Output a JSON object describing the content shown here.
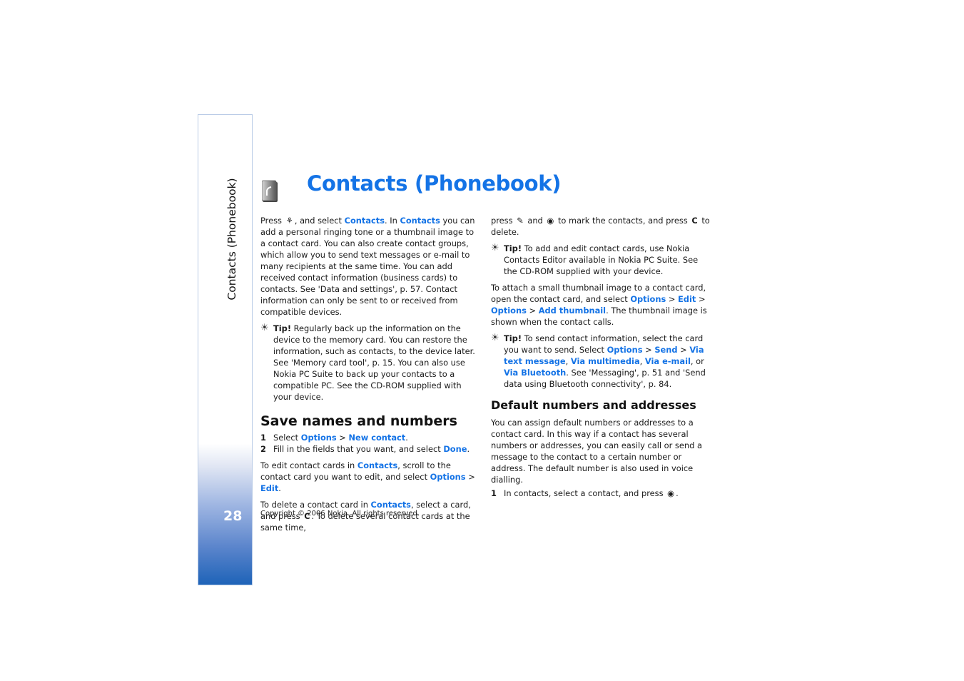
{
  "sidebar": {
    "section_title": "Contacts (Phonebook)",
    "page_number": "28",
    "gradient_colors": [
      "#ffffff",
      "#9fb6e2",
      "#1e63b8"
    ]
  },
  "header": {
    "title": "Contacts (Phonebook)",
    "icon": "contacts-book-icon",
    "accent_color": "#1473e6"
  },
  "col1": {
    "intro": {
      "t1": "Press ",
      "t2": ", and select ",
      "k1": "Contacts",
      "t3": ". In ",
      "k2": "Contacts",
      "t4": " you can add a personal ringing tone or a thumbnail image to a contact card. You can also create contact groups, which allow you to send text messages or e-mail to many recipients at the same time. You can add received contact information (business cards) to contacts. See 'Data and settings', p. 57. Contact information can only be sent to or received from compatible devices."
    },
    "tip": {
      "label": "Tip!",
      "text": " Regularly back up the information on the device to the memory card. You can restore the information, such as contacts, to the device later. See 'Memory card tool', p. 15. You can also use Nokia PC Suite to back up your contacts to a compatible PC. See the CD-ROM supplied with your device."
    },
    "heading": "Save names and numbers",
    "steps": [
      {
        "num": "1",
        "t1": "Select ",
        "k1": "Options",
        "t2": " > ",
        "k2": "New contact",
        "t3": "."
      },
      {
        "num": "2",
        "t1": "Fill in the fields that you want, and select ",
        "k1": "Done",
        "t2": "."
      }
    ],
    "edit": {
      "t1": "To edit contact cards in ",
      "k1": "Contacts",
      "t2": ", scroll to the contact card you want to edit, and select ",
      "k2": "Options",
      "t3": " > ",
      "k3": "Edit",
      "t4": "."
    },
    "delete": {
      "t1": "To delete a contact card in ",
      "k1": "Contacts",
      "t2": ", select a card, and press ",
      "t3": ". To delete several contact cards at the same time,"
    }
  },
  "col2": {
    "cont": {
      "t1": "press ",
      "t2": " and ",
      "t3": " to mark the contacts, and press ",
      "t4": " to delete."
    },
    "tip1": {
      "label": "Tip!",
      "text": " To add and edit contact cards, use Nokia Contacts Editor available in Nokia PC Suite. See the CD-ROM supplied with your device."
    },
    "thumb": {
      "t1": "To attach a small thumbnail image to a contact card, open the contact card, and select ",
      "k1": "Options",
      "t2": " > ",
      "k2": "Edit",
      "t3": " > ",
      "k3": "Options",
      "t4": " > ",
      "k4": "Add thumbnail",
      "t5": ". The thumbnail image is shown when the contact calls."
    },
    "tip2": {
      "label": "Tip!",
      "t1": " To send contact information, select the card you want to send. Select ",
      "k1": "Options",
      "t2": " > ",
      "k2": "Send",
      "t3": " > ",
      "k3": "Via text message",
      "t4": ", ",
      "k4": "Via multimedia",
      "t5": ", ",
      "k5": "Via e-mail",
      "t6": ", or ",
      "k6": "Via Bluetooth",
      "t7": ". See 'Messaging', p. 51 and 'Send data using Bluetooth connectivity', p. 84."
    },
    "heading": "Default numbers and addresses",
    "body": "You can assign default numbers or addresses to a contact card. In this way if a contact has several numbers or addresses, you can easily call or send a message to the contact to a certain number or address. The default number is also used in voice dialling.",
    "step": {
      "num": "1",
      "t1": "In contacts, select a contact, and press ",
      "t2": "."
    }
  },
  "footer": {
    "copyright": "Copyright © 2006 Nokia. All rights reserved."
  },
  "glyphs": {
    "menu": "⚘",
    "clear": "C",
    "edit": "✎",
    "select": "◉",
    "tip": "☀"
  }
}
